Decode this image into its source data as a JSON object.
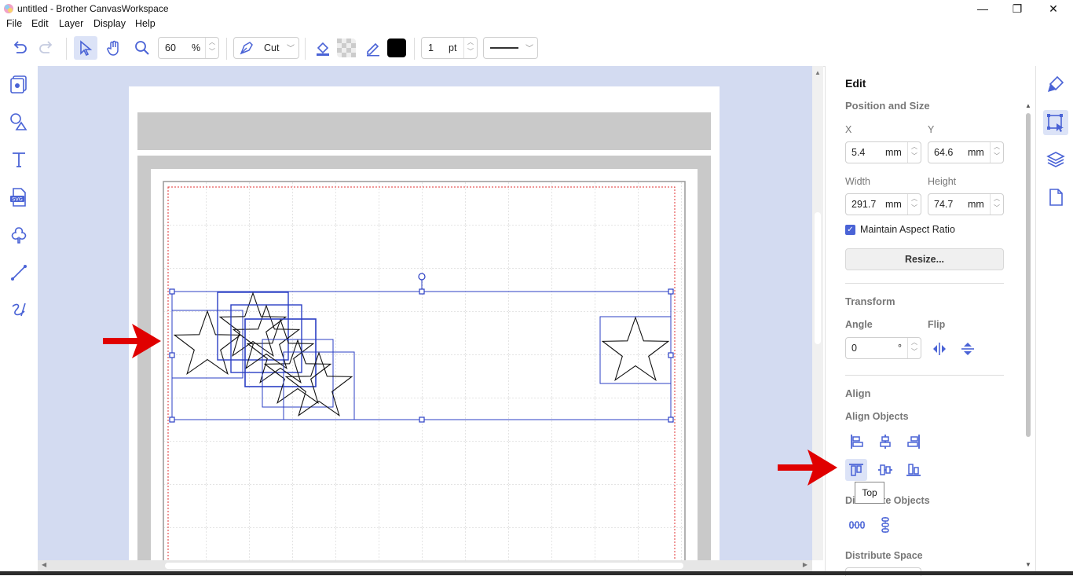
{
  "window": {
    "title": "untitled - Brother CanvasWorkspace",
    "minimize": "—",
    "restore": "❐",
    "close": "✕"
  },
  "menu": [
    "File",
    "Edit",
    "Layer",
    "Display",
    "Help"
  ],
  "toolbar": {
    "zoom_value": "60",
    "zoom_unit": "%",
    "mode_label": "Cut",
    "line_width_value": "1",
    "line_width_unit": "pt",
    "stroke_color": "#000000"
  },
  "left_tools": [
    "project-icon",
    "shapes-icon",
    "text-icon",
    "svg-icon",
    "cloud-shape-icon",
    "line-icon",
    "freehand-icon"
  ],
  "panel": {
    "title": "Edit",
    "position_size": {
      "heading": "Position and Size",
      "x_label": "X",
      "x_value": "5.4",
      "x_unit": "mm",
      "y_label": "Y",
      "y_value": "64.6",
      "y_unit": "mm",
      "width_label": "Width",
      "width_value": "291.7",
      "width_unit": "mm",
      "height_label": "Height",
      "height_value": "74.7",
      "height_unit": "mm",
      "aspect_label": "Maintain Aspect Ratio",
      "aspect_checked": true,
      "resize_label": "Resize..."
    },
    "transform": {
      "heading": "Transform",
      "angle_label": "Angle",
      "angle_value": "0",
      "angle_unit": "°",
      "flip_label": "Flip"
    },
    "align": {
      "heading": "Align",
      "align_objects_label": "Align Objects",
      "distribute_objects_label": "Distribute Objects",
      "distribute_space_label": "Distribute Space"
    },
    "tooltip": "Top"
  },
  "accent_color": "#4a63d6",
  "arrow_color": "#e00000"
}
